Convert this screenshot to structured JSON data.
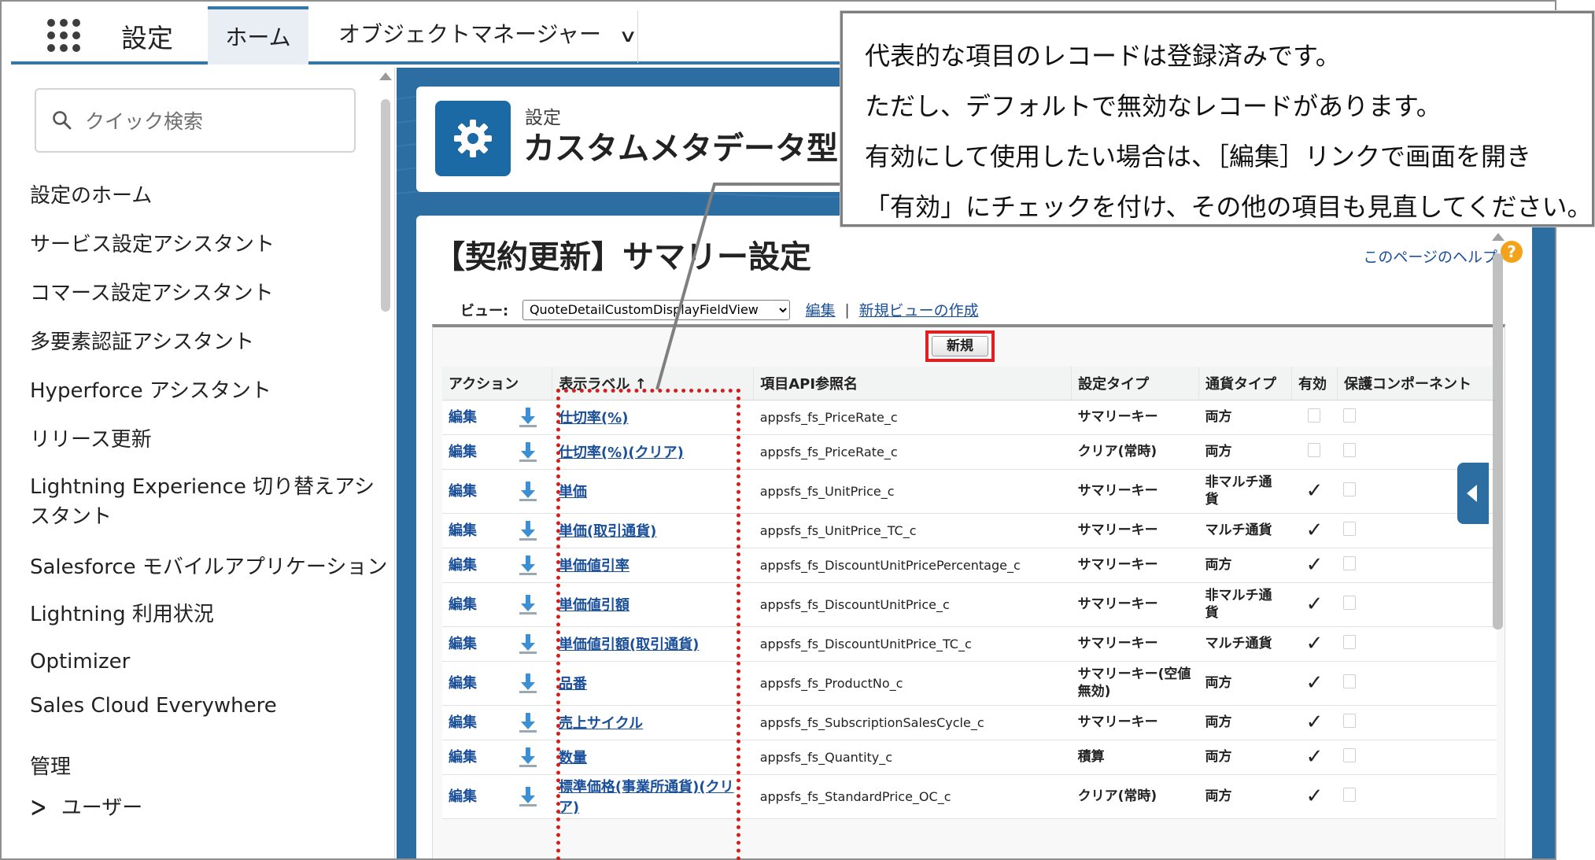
{
  "topbar": {
    "app_name": "設定",
    "tabs": [
      {
        "label": "ホーム"
      },
      {
        "label": "オブジェクトマネージャー"
      }
    ]
  },
  "sidebar": {
    "search_placeholder": "クイック検索",
    "items": [
      "設定のホーム",
      "サービス設定アシスタント",
      "コマース設定アシスタント",
      "多要素認証アシスタント",
      "Hyperforce アシスタント",
      "リリース更新",
      "Lightning Experience 切り替えアシスタント",
      "Salesforce モバイルアプリケーション",
      "Lightning 利用状況",
      "Optimizer",
      "Sales Cloud Everywhere"
    ],
    "section_heading": "管理",
    "section_items": [
      "ユーザー"
    ]
  },
  "header": {
    "breadcrumb": "設定",
    "title": "カスタムメタデータ型"
  },
  "page": {
    "title": "【契約更新】サマリー設定",
    "help_link": "このページのヘルプ",
    "view_label": "ビュー:",
    "view_selected": "QuoteDetailCustomDisplayFieldView",
    "edit_link": "編集",
    "separator": "|",
    "new_view_link": "新規ビューの作成",
    "new_button": "新規"
  },
  "table": {
    "headers": [
      "アクション",
      "表示ラベル ↑",
      "項目API参照名",
      "設定タイプ",
      "通貨タイプ",
      "有効",
      "保護コンポーネント"
    ],
    "action_label": "編集",
    "rows": [
      {
        "label": "仕切率(%)",
        "api": "appsfs_fs_PriceRate_c",
        "type": "サマリーキー",
        "currency": "両方",
        "active": false,
        "h": 44
      },
      {
        "label": "仕切率(%)(クリア)",
        "api": "appsfs_fs_PriceRate_c",
        "type": "クリア(常時)",
        "currency": "両方",
        "active": false,
        "h": 44
      },
      {
        "label": "単価",
        "api": "appsfs_fs_UnitPrice_c",
        "type": "サマリーキー",
        "currency": "非マルチ通貨",
        "active": true,
        "h": 56
      },
      {
        "label": "単価(取引通貨)",
        "api": "appsfs_fs_UnitPrice_TC_c",
        "type": "サマリーキー",
        "currency": "マルチ通貨",
        "active": true,
        "h": 44
      },
      {
        "label": "単価値引率",
        "api": "appsfs_fs_DiscountUnitPricePercentage_c",
        "type": "サマリーキー",
        "currency": "両方",
        "active": true,
        "h": 44
      },
      {
        "label": "単価値引額",
        "api": "appsfs_fs_DiscountUnitPrice_c",
        "type": "サマリーキー",
        "currency": "非マルチ通貨",
        "active": true,
        "h": 56
      },
      {
        "label": "単価値引額(取引通貨)",
        "api": "appsfs_fs_DiscountUnitPrice_TC_c",
        "type": "サマリーキー",
        "currency": "マルチ通貨",
        "active": true,
        "h": 44
      },
      {
        "label": "品番",
        "api": "appsfs_fs_ProductNo_c",
        "type": "サマリーキー(空値無効)",
        "currency": "両方",
        "active": true,
        "h": 56
      },
      {
        "label": "売上サイクル",
        "api": "appsfs_fs_SubscriptionSalesCycle_c",
        "type": "サマリーキー",
        "currency": "両方",
        "active": true,
        "h": 44
      },
      {
        "label": "数量",
        "api": "appsfs_fs_Quantity_c",
        "type": "積算",
        "currency": "両方",
        "active": true,
        "h": 44
      },
      {
        "label": "標準価格(事業所通貨)(クリア)",
        "api": "appsfs_fs_StandardPrice_OC_c",
        "type": "クリア(常時)",
        "currency": "両方",
        "active": true,
        "h": 56
      }
    ]
  },
  "callout": {
    "lines": [
      "代表的な項目のレコードは登録済みです。",
      "ただし、デフォルトで無効なレコードがあります。",
      "有効にして使用したい場合は、［編集］リンクで画面を開き",
      "「有効」にチェックを付け、その他の項目も見直してください。"
    ]
  },
  "colors": {
    "brand_blue": "#2c6da2",
    "link_blue": "#1a4f9a",
    "highlight_red": "#e02020"
  }
}
